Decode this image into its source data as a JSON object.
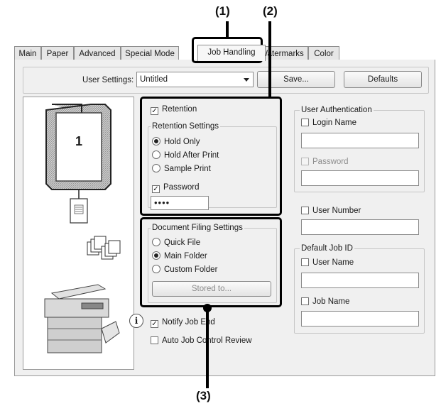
{
  "callouts": {
    "c1": "(1)",
    "c2": "(2)",
    "c3": "(3)"
  },
  "tabs": [
    "Main",
    "Paper",
    "Advanced",
    "Special Mode",
    "Job Handling",
    "Watermarks",
    "Color"
  ],
  "user_settings": {
    "label": "User Settings:",
    "value": "Untitled",
    "save": "Save...",
    "defaults": "Defaults"
  },
  "preview": {
    "page_number": "1"
  },
  "retention": {
    "checkbox": "Retention",
    "group": "Retention Settings",
    "options": [
      "Hold Only",
      "Hold After Print",
      "Sample Print"
    ],
    "selected": "Hold Only",
    "password_label": "Password",
    "password_value": "••••"
  },
  "filing": {
    "group": "Document Filing Settings",
    "options": [
      "Quick File",
      "Main Folder",
      "Custom Folder"
    ],
    "selected": "Main Folder",
    "stored_to": "Stored to..."
  },
  "notify": "Notify Job End",
  "auto_review": "Auto Job Control Review",
  "user_auth": {
    "group": "User Authentication",
    "login_name": "Login Name",
    "password": "Password"
  },
  "user_number": "User Number",
  "default_job": {
    "group": "Default Job ID",
    "user_name": "User Name",
    "job_name": "Job Name"
  }
}
